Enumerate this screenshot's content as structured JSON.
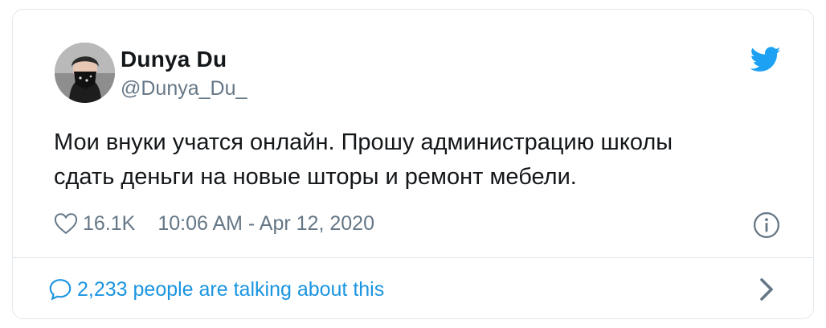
{
  "user": {
    "display_name": "Dunya Du",
    "handle": "@Dunya_Du_",
    "avatar_icon": "avatar-masked-person"
  },
  "tweet": {
    "text_line1": "Мои внуки учатся онлайн. Прошу администрацию школы",
    "text_line2": "сдать деньги на новые шторы и ремонт мебели."
  },
  "meta": {
    "likes": "16.1K",
    "timestamp": "10:06 AM - Apr 12, 2020"
  },
  "footer": {
    "talking": "2,233 people are talking about this"
  },
  "icons": {
    "brand": "twitter-bird-icon",
    "like": "heart-icon",
    "info": "info-icon",
    "reply": "speech-bubble-icon",
    "more": "chevron-right-icon"
  },
  "colors": {
    "brand_blue": "#1da1f2",
    "link_blue": "#1b95e0",
    "secondary_text": "#657786",
    "border": "#e1e8ed"
  }
}
